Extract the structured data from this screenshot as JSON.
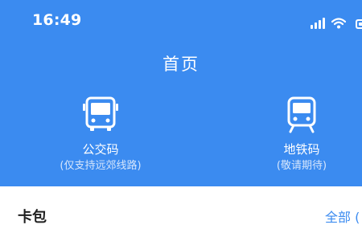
{
  "status_bar": {
    "time": "16:49",
    "icons": [
      "signal-icon",
      "wifi-icon",
      "battery-icon"
    ]
  },
  "header": {
    "title": "首页",
    "background_color": "#3b8bf0"
  },
  "codes": [
    {
      "label": "公交码",
      "sublabel": "(仅支持远郊线路)",
      "icon": "bus-icon"
    },
    {
      "label": "地铁码",
      "sublabel": "(敬请期待)",
      "icon": "metro-icon"
    }
  ],
  "card_wallet": {
    "title": "卡包",
    "view_all_label": "全部 ("
  },
  "colors": {
    "accent": "#3b8bf0",
    "panel": "#ffffff",
    "text": "#1f1f1f"
  }
}
